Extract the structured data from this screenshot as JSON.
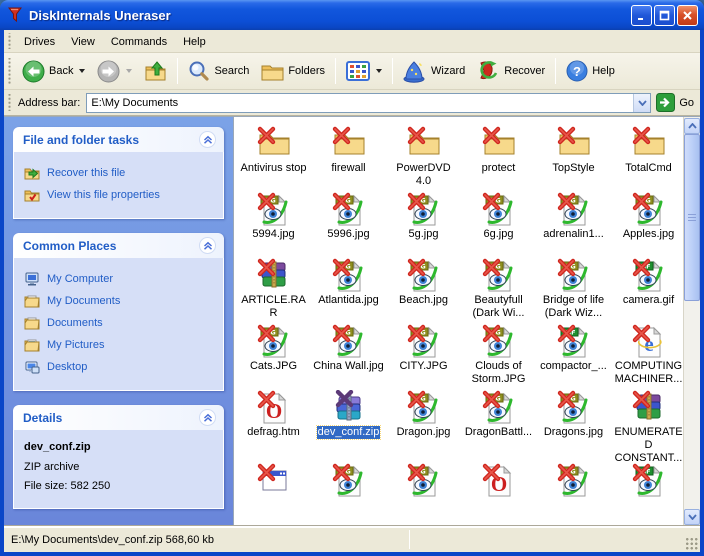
{
  "window": {
    "title": "DiskInternals Uneraser",
    "controls": {
      "minimize": "minimize",
      "maximize": "maximize",
      "close": "close"
    }
  },
  "menu": {
    "items": [
      "Drives",
      "View",
      "Commands",
      "Help"
    ]
  },
  "toolbar": {
    "back_label": "Back",
    "search_label": "Search",
    "folders_label": "Folders",
    "wizard_label": "Wizard",
    "recover_label": "Recover",
    "help_label": "Help"
  },
  "address_bar": {
    "label": "Address bar:",
    "value": "E:\\My Documents",
    "go_label": "Go"
  },
  "sidebar": {
    "tasks_panel": {
      "title": "File and folder tasks",
      "items": [
        {
          "label": "Recover this file",
          "icon": "recover-file-icon"
        },
        {
          "label": "View this file properties",
          "icon": "file-properties-icon"
        }
      ]
    },
    "places_panel": {
      "title": "Common Places",
      "items": [
        {
          "label": "My Computer",
          "icon": "my-computer-icon"
        },
        {
          "label": "My Documents",
          "icon": "my-documents-icon"
        },
        {
          "label": "Documents",
          "icon": "documents-icon"
        },
        {
          "label": "My Pictures",
          "icon": "my-pictures-icon"
        },
        {
          "label": "Desktop",
          "icon": "desktop-icon"
        }
      ]
    },
    "details_panel": {
      "title": "Details",
      "file_name": "dev_conf.zip",
      "file_type": "ZIP archive",
      "file_size": "File size: 582 250"
    }
  },
  "files": [
    {
      "label": "Antivirus stop",
      "icon": "folder"
    },
    {
      "label": "firewall",
      "icon": "folder"
    },
    {
      "label": "PowerDVD 4.0",
      "icon": "folder"
    },
    {
      "label": "protect",
      "icon": "folder"
    },
    {
      "label": "TopStyle",
      "icon": "folder"
    },
    {
      "label": "TotalCmd",
      "icon": "folder"
    },
    {
      "label": "5994.jpg",
      "icon": "jpg"
    },
    {
      "label": "5996.jpg",
      "icon": "jpg"
    },
    {
      "label": "5g.jpg",
      "icon": "jpg"
    },
    {
      "label": "6g.jpg",
      "icon": "jpg"
    },
    {
      "label": "adrenalin1...",
      "icon": "jpg"
    },
    {
      "label": "Apples.jpg",
      "icon": "jpg"
    },
    {
      "label": "ARTICLE.RAR",
      "icon": "rar"
    },
    {
      "label": "Atlantida.jpg",
      "icon": "jpg"
    },
    {
      "label": "Beach.jpg",
      "icon": "jpg"
    },
    {
      "label": "Beautyfull (Dark Wi...",
      "icon": "jpg"
    },
    {
      "label": "Bridge of life (Dark Wiz...",
      "icon": "jpg"
    },
    {
      "label": "camera.gif",
      "icon": "gif"
    },
    {
      "label": "Cats.JPG",
      "icon": "jpg"
    },
    {
      "label": "China Wall.jpg",
      "icon": "jpg"
    },
    {
      "label": "CITY.JPG",
      "icon": "jpg"
    },
    {
      "label": "Clouds of Storm.JPG",
      "icon": "jpg"
    },
    {
      "label": "compactor_...",
      "icon": "gif"
    },
    {
      "label": "COMPUTING MACHINER...",
      "icon": "ie"
    },
    {
      "label": "defrag.htm",
      "icon": "opera"
    },
    {
      "label": "dev_conf.zip",
      "icon": "zip",
      "selected": true
    },
    {
      "label": "Dragon.jpg",
      "icon": "jpg"
    },
    {
      "label": "DragonBattl...",
      "icon": "jpg"
    },
    {
      "label": "Dragons.jpg",
      "icon": "jpg"
    },
    {
      "label": "ENUMERATED CONSTANT...",
      "icon": "rar"
    },
    {
      "label": "",
      "icon": "window"
    },
    {
      "label": "",
      "icon": "jpg"
    },
    {
      "label": "",
      "icon": "jpg"
    },
    {
      "label": "",
      "icon": "opera"
    },
    {
      "label": "",
      "icon": "jpg"
    },
    {
      "label": "",
      "icon": "gif"
    }
  ],
  "status_bar": {
    "text": "E:\\My Documents\\dev_conf.zip 568,60 kb"
  },
  "colors": {
    "titlebar_blue": "#0c4fd6",
    "selection_blue": "#316ac5",
    "sidebar_blue": "#7ba2e7",
    "panel_body": "#d6dff7",
    "link_blue": "#215dc6",
    "toolbar_beige": "#ece9d8",
    "deleted_x_red": "#cf271f",
    "go_green": "#2d9e3a"
  }
}
